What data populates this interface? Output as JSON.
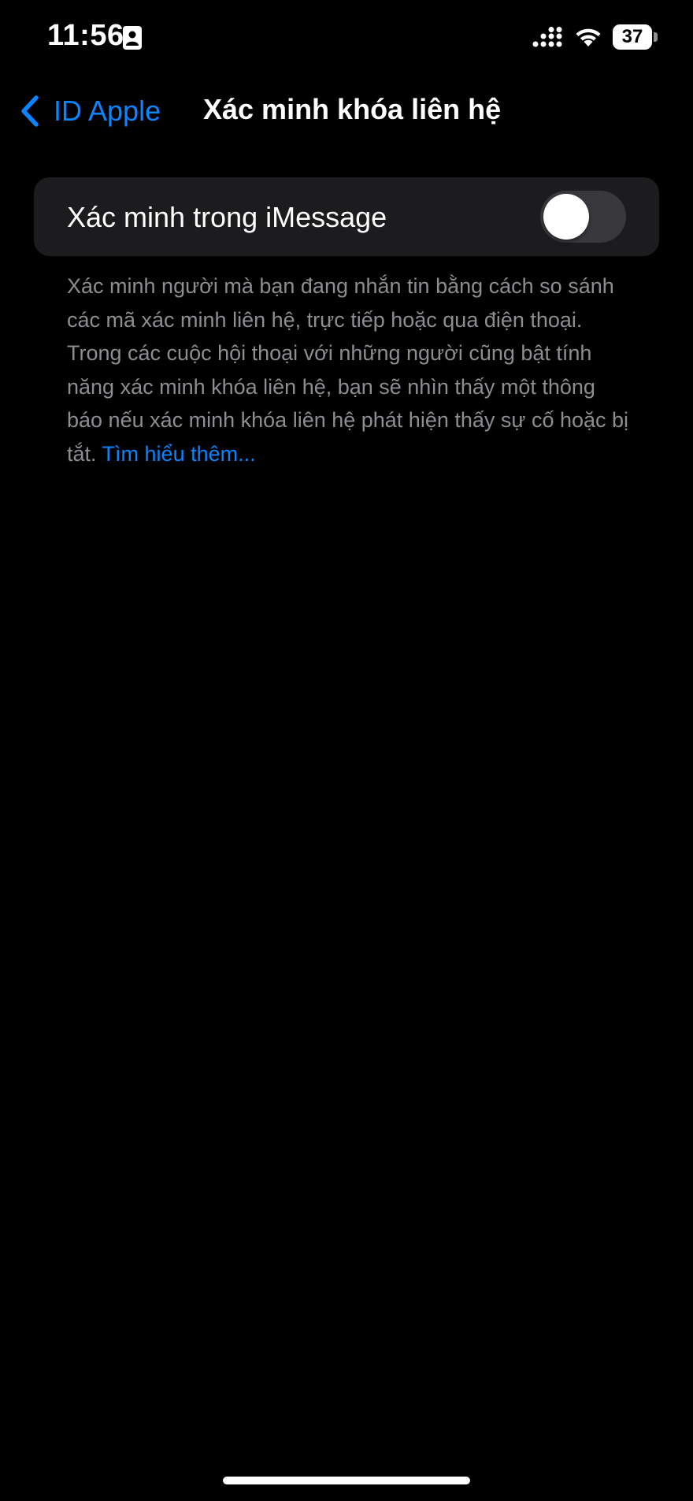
{
  "status_bar": {
    "time": "11:56",
    "battery_level": "37",
    "icons": [
      "contact-card-icon",
      "signal-icon",
      "wifi-icon",
      "battery-icon"
    ]
  },
  "nav": {
    "back_label": "ID Apple",
    "title": "Xác minh khóa liên hệ"
  },
  "settings": {
    "imessage_verification": {
      "label": "Xác minh trong iMessage",
      "enabled": false
    }
  },
  "footer": {
    "description": "Xác minh người mà bạn đang nhắn tin bằng cách so sánh các mã xác minh liên hệ, trực tiếp hoặc qua điện thoại. Trong các cuộc hội thoại với những người cũng bật tính năng xác minh khóa liên hệ, bạn sẽ nhìn thấy một thông báo nếu xác minh khóa liên hệ phát hiện thấy sự cố hoặc bị tắt.",
    "learn_more": "Tìm hiểu thêm..."
  },
  "colors": {
    "background": "#000000",
    "cell_background": "#1c1c1e",
    "accent": "#0a84ff",
    "secondary_text": "#8d8d92",
    "toggle_off": "#39393d"
  }
}
